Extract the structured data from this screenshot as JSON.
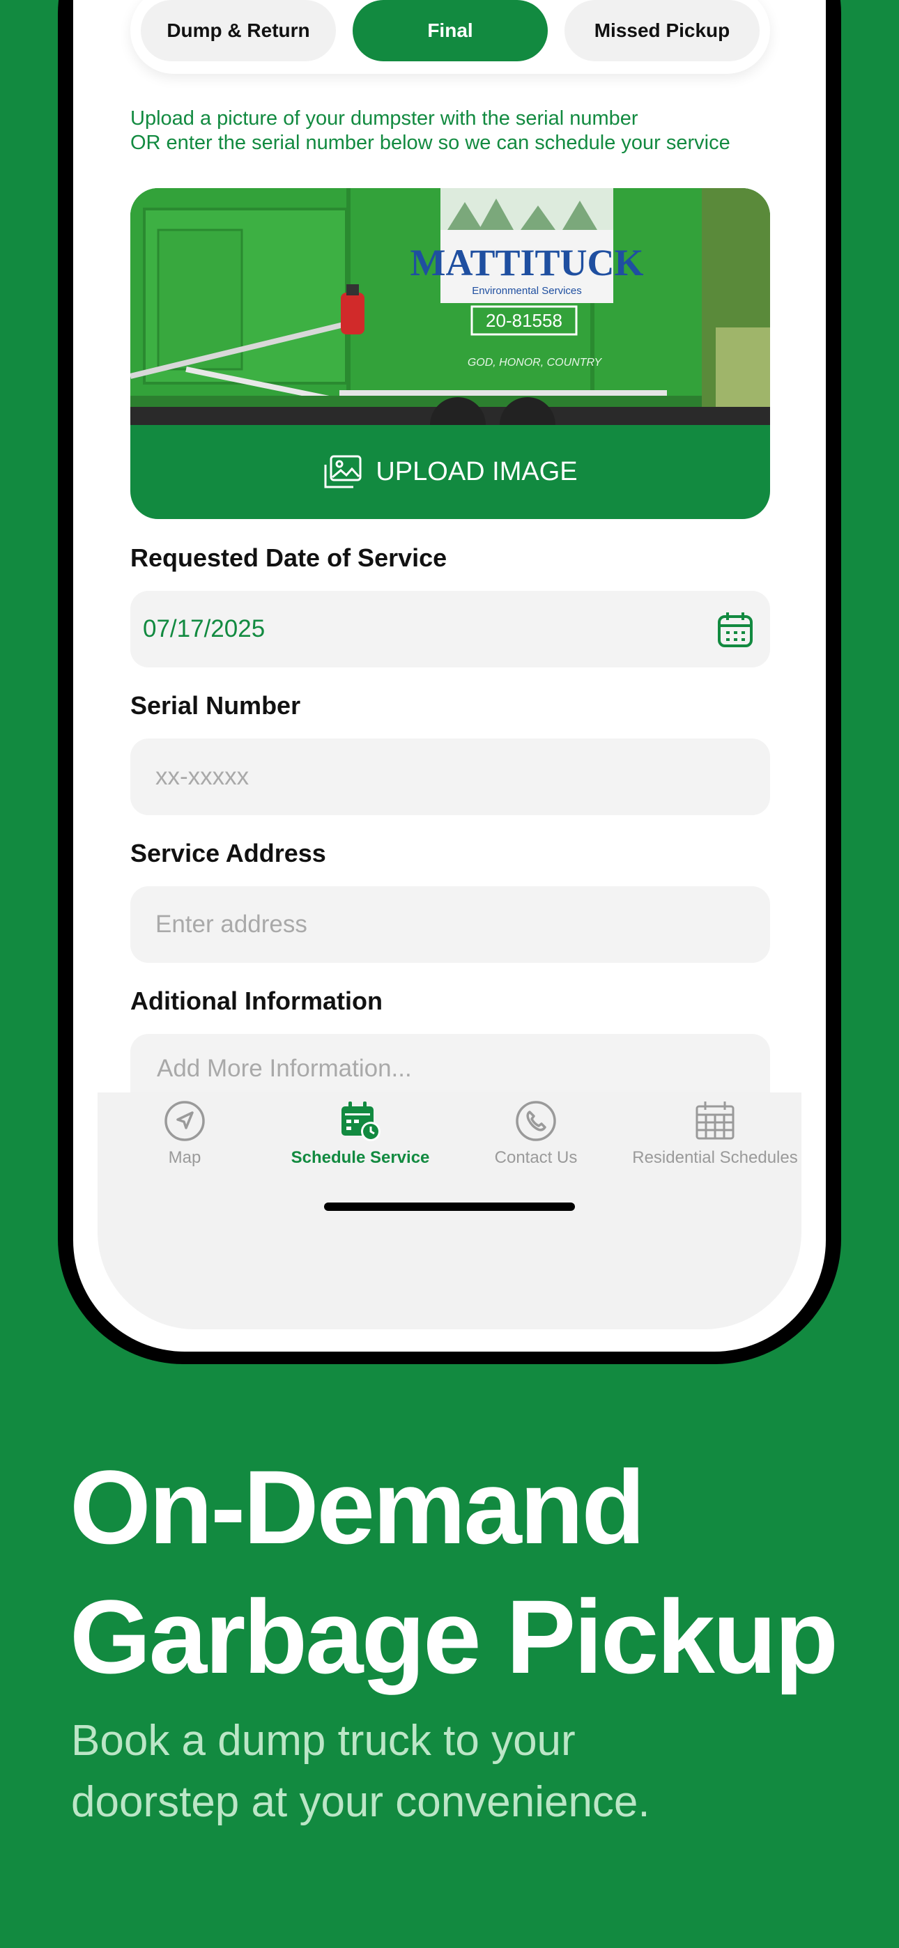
{
  "segments": [
    {
      "label": "Dump & Return",
      "active": false
    },
    {
      "label": "Final",
      "active": true
    },
    {
      "label": "Missed Pickup",
      "active": false
    }
  ],
  "instructions": {
    "line1": "Upload a picture of your dumpster with the serial number",
    "line2": "OR enter the serial number below so we can schedule your service"
  },
  "upload": {
    "button_label": "UPLOAD IMAGE",
    "icon": "image-icon",
    "photo": {
      "brand": "MATTITUCK",
      "brand_sub": "Environmental Services",
      "serial": "20-81558",
      "motto": "GOD, HONOR, COUNTRY"
    }
  },
  "form": {
    "date_label": "Requested Date of Service",
    "date_value": "07/17/2025",
    "date_icon": "calendar-icon",
    "serial_label": "Serial Number",
    "serial_placeholder": "xx-xxxxx",
    "address_label": "Service Address",
    "address_placeholder": "Enter address",
    "info_label": "Aditional Information",
    "info_placeholder": "Add More Information..."
  },
  "tabbar": {
    "items": [
      {
        "label": "Map",
        "icon": "navigation-arrow-icon",
        "active": false
      },
      {
        "label": "Schedule Service",
        "icon": "calendar-clock-icon",
        "active": true
      },
      {
        "label": "Contact Us",
        "icon": "phone-icon",
        "active": false
      },
      {
        "label": "Residential Schedules",
        "icon": "calendar-grid-icon",
        "active": false
      }
    ]
  },
  "marketing": {
    "headline_line1": "On-Demand",
    "headline_line2": "Garbage Pickup",
    "sub_line1": "Book a dump truck to your",
    "sub_line2": "doorstep at your convenience."
  },
  "colors": {
    "brand_green": "#128A40",
    "field_bg": "#F3F3F3",
    "placeholder": "#A9A9A9",
    "subtext": "#BCE6C7"
  }
}
